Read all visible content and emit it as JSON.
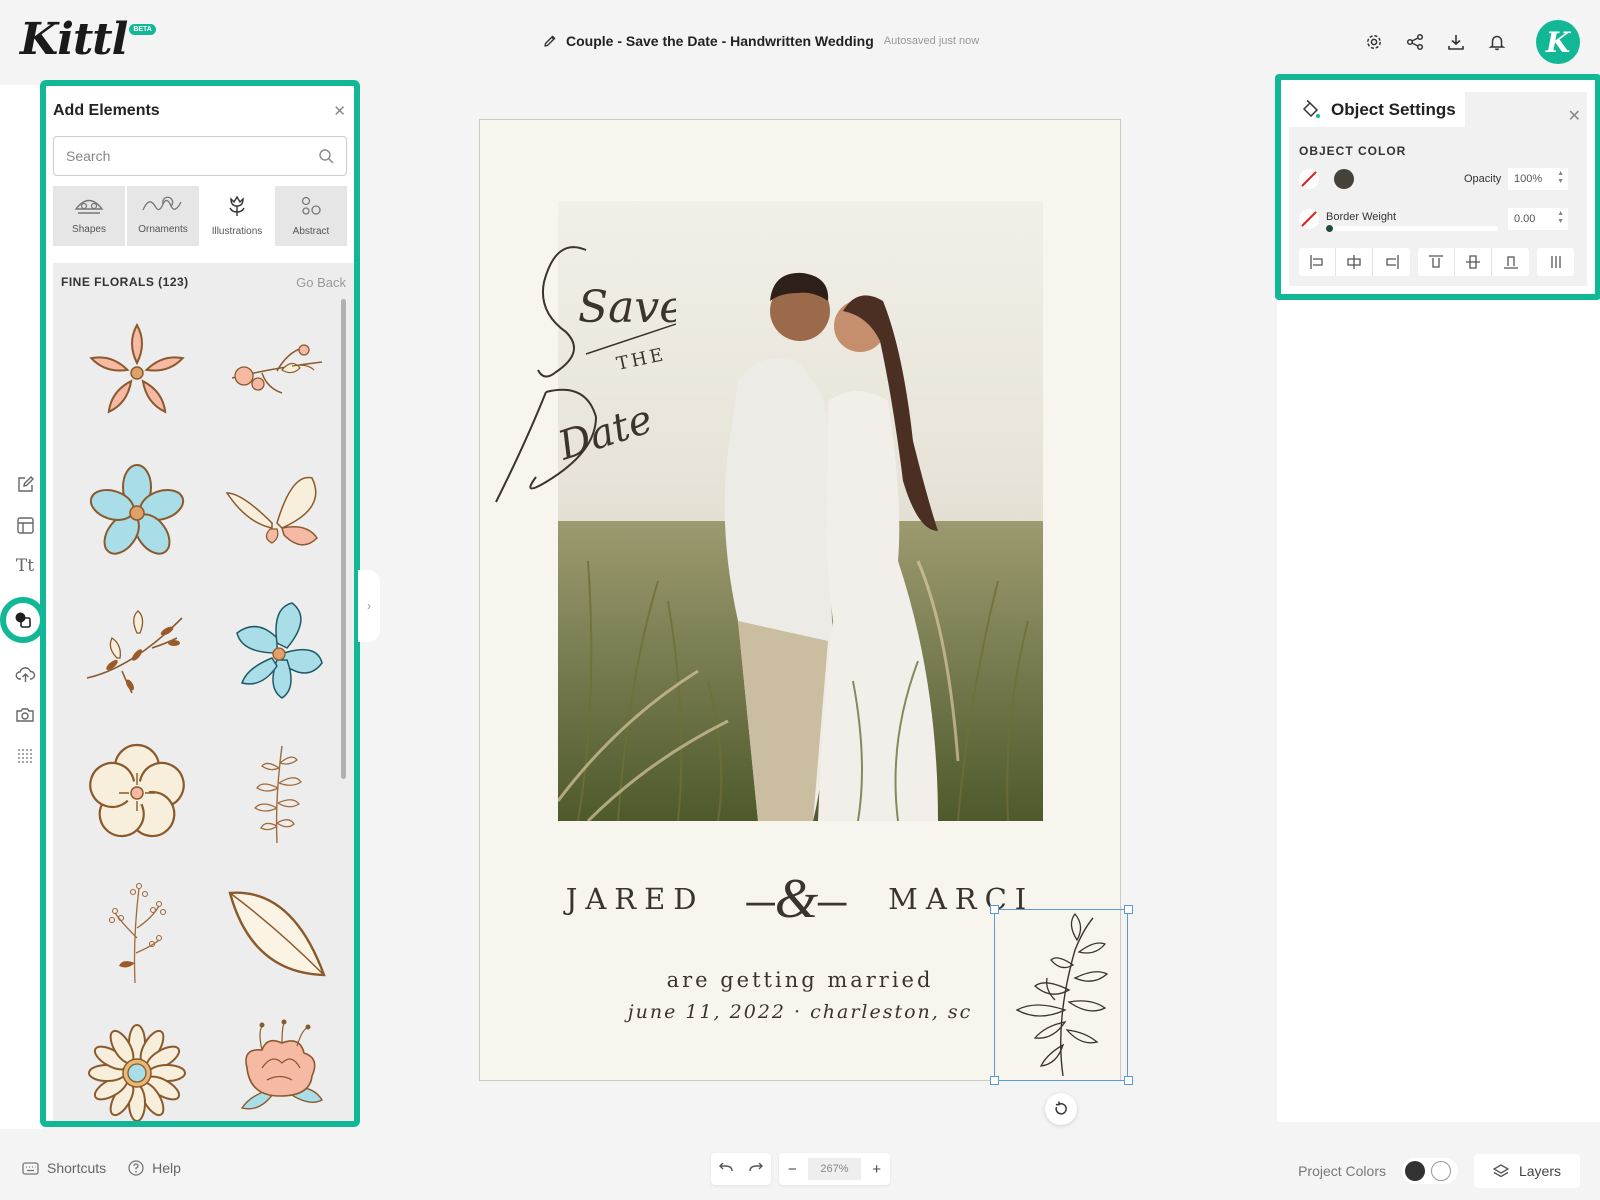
{
  "app": {
    "logo": "Kittl",
    "badge": "BETA"
  },
  "document": {
    "title": "Couple - Save the Date - Handwritten Wedding",
    "autosave": "Autosaved just now"
  },
  "header_icons": [
    "gear-icon",
    "share-icon",
    "download-icon",
    "bell-icon"
  ],
  "avatar_letter": "K",
  "rail_icons": [
    "edit-icon",
    "layout-icon",
    "text-icon",
    "elements-icon",
    "upload-icon",
    "camera-icon",
    "grid-dots-icon"
  ],
  "add_elements": {
    "title": "Add Elements",
    "search_placeholder": "Search",
    "categories": [
      {
        "label": "Shapes"
      },
      {
        "label": "Ornaments"
      },
      {
        "label": "Illustrations"
      },
      {
        "label": "Abstract"
      }
    ],
    "active_category": "Illustrations",
    "list_title": "FINE FLORALS (123)",
    "go_back": "Go Back",
    "items": [
      "pink-five-petal-flower",
      "pink-flowering-branch",
      "blue-five-petal-flower",
      "cream-butterfly",
      "brown-leafy-sprig",
      "blue-hibiscus",
      "cream-open-flower",
      "brown-fern-sprig",
      "brown-berry-sprig",
      "brown-leaf",
      "cream-daisy",
      "pink-peony"
    ]
  },
  "card": {
    "script_save": "Save",
    "script_the": "THE",
    "script_date": "Date",
    "name_left": "JARED",
    "ampersand": "–&–",
    "name_right": "MARCI",
    "line1": "are getting married",
    "line2": "june 11, 2022 · charleston, sc"
  },
  "object_settings": {
    "title": "Object Settings",
    "section": "OBJECT COLOR",
    "color": "#45423a",
    "opacity_label": "Opacity",
    "opacity_value": "100%",
    "border_label": "Border Weight",
    "border_value": "0.00",
    "border_weight_level": 0
  },
  "bottom": {
    "shortcuts": "Shortcuts",
    "help": "Help",
    "zoom": "267%",
    "project_colors": "Project Colors",
    "layers": "Layers"
  },
  "colors": {
    "accent": "#12b896",
    "canvas": "#f8f5ef",
    "ink": "#3a342d"
  }
}
